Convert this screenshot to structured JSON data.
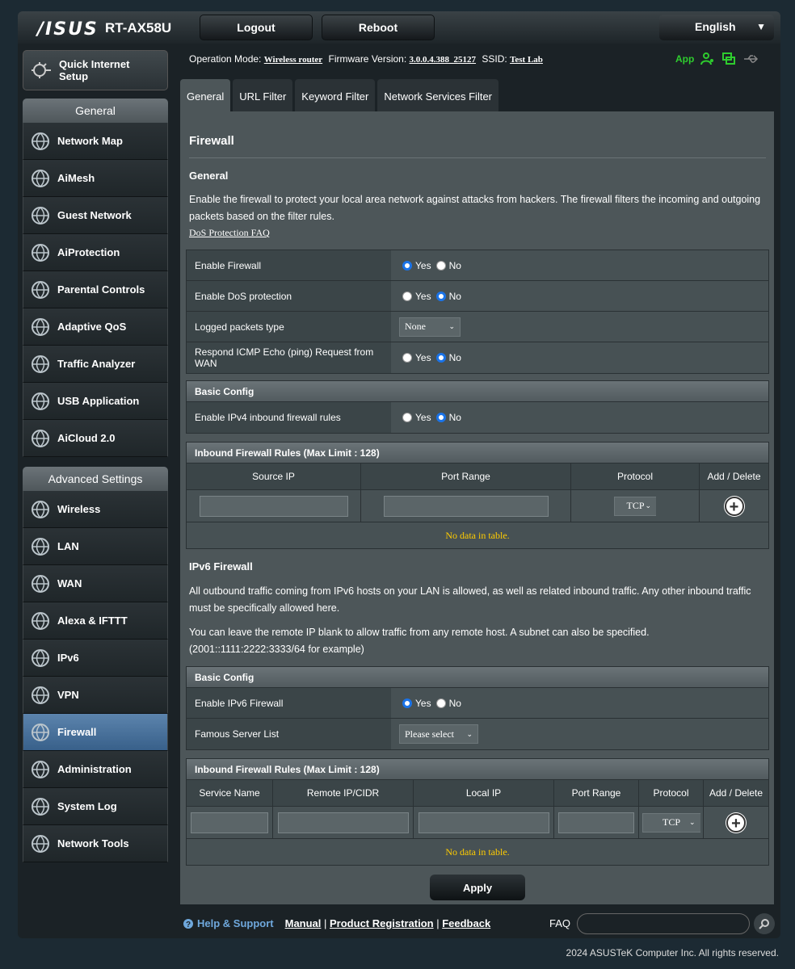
{
  "header": {
    "logo": "/ISUS",
    "model": "RT-AX58U",
    "logout_label": "Logout",
    "reboot_label": "Reboot",
    "language": "English"
  },
  "status": {
    "op_mode_label": "Operation Mode:",
    "op_mode_value": "Wireless router",
    "fw_label": "Firmware Version:",
    "fw_value": "3.0.0.4.388_25127",
    "ssid_label": "SSID:",
    "ssid_value": "Test Lab",
    "app_label": "App"
  },
  "sidebar": {
    "qis_label": "Quick Internet Setup",
    "general_header": "General",
    "general_items": [
      {
        "label": "Network Map",
        "icon": "globe-icon"
      },
      {
        "label": "AiMesh",
        "icon": "mesh-icon"
      },
      {
        "label": "Guest Network",
        "icon": "guest-network-icon"
      },
      {
        "label": "AiProtection",
        "icon": "lock-icon"
      },
      {
        "label": "Parental Controls",
        "icon": "parental-icon"
      },
      {
        "label": "Adaptive QoS",
        "icon": "gauge-icon"
      },
      {
        "label": "Traffic Analyzer",
        "icon": "traffic-icon"
      },
      {
        "label": "USB Application",
        "icon": "usb-icon"
      },
      {
        "label": "AiCloud 2.0",
        "icon": "cloud-icon"
      }
    ],
    "advanced_header": "Advanced Settings",
    "advanced_items": [
      {
        "label": "Wireless",
        "icon": "wifi-icon"
      },
      {
        "label": "LAN",
        "icon": "lan-icon"
      },
      {
        "label": "WAN",
        "icon": "wan-globe-icon"
      },
      {
        "label": "Alexa & IFTTT",
        "icon": "alexa-icon"
      },
      {
        "label": "IPv6",
        "icon": "ipv6-icon"
      },
      {
        "label": "VPN",
        "icon": "vpn-icon"
      },
      {
        "label": "Firewall",
        "icon": "firewall-icon"
      },
      {
        "label": "Administration",
        "icon": "admin-icon"
      },
      {
        "label": "System Log",
        "icon": "log-icon"
      },
      {
        "label": "Network Tools",
        "icon": "tools-icon"
      }
    ]
  },
  "tabs": [
    "General",
    "URL Filter",
    "Keyword Filter",
    "Network Services Filter"
  ],
  "page": {
    "title": "Firewall",
    "general_heading": "General",
    "general_desc": "Enable the firewall to protect your local area network against attacks from hackers. The firewall filters the incoming and outgoing packets based on the filter rules.",
    "dos_link": "DoS Protection FAQ",
    "settings": {
      "enable_firewall": "Enable Firewall",
      "enable_dos": "Enable DoS protection",
      "logged_packets": "Logged packets type",
      "logged_packets_value": "None",
      "icmp": "Respond ICMP Echo (ping) Request from WAN"
    },
    "yes": "Yes",
    "no": "No",
    "basic_config": "Basic Config",
    "ipv4_inbound": "Enable IPv4 inbound firewall rules",
    "inbound_header": "Inbound Firewall Rules (Max Limit : 128)",
    "v4_cols": [
      "Source IP",
      "Port Range",
      "Protocol",
      "Add / Delete"
    ],
    "protocol_value": "TCP",
    "no_data": "No data in table.",
    "ipv6_heading": "IPv6 Firewall",
    "ipv6_desc1": "All outbound traffic coming from IPv6 hosts on your LAN is allowed, as well as related inbound traffic. Any other inbound traffic must be specifically allowed here.",
    "ipv6_desc2": "You can leave the remote IP blank to allow traffic from any remote host. A subnet can also be specified. (2001::1111:2222:3333/64 for example)",
    "enable_ipv6_fw": "Enable IPv6 Firewall",
    "famous_server": "Famous Server List",
    "famous_server_value": "Please select",
    "v6_cols": [
      "Service Name",
      "Remote IP/CIDR",
      "Local IP",
      "Port Range",
      "Protocol",
      "Add / Delete"
    ],
    "apply_label": "Apply"
  },
  "footer": {
    "help": "Help & Support",
    "manual": "Manual",
    "registration": "Product Registration",
    "feedback": "Feedback",
    "faq": "FAQ",
    "copyright": "2024 ASUSTeK Computer Inc. All rights reserved."
  },
  "colors": {
    "accent": "#1a73e8",
    "active_nav": "#4a72a0",
    "nodata": "#ffcc00",
    "app_green": "#2ecc2e"
  }
}
